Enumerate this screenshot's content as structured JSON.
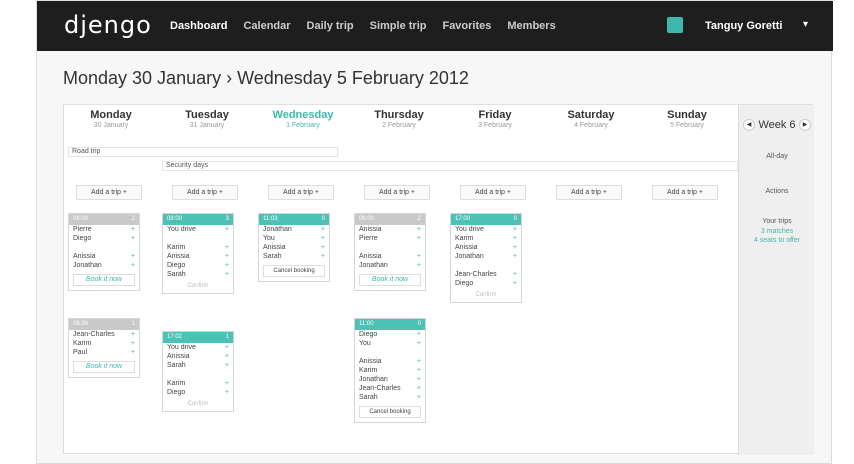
{
  "app": {
    "logo": "djengo",
    "nav": [
      "Dashboard",
      "Calendar",
      "Daily trip",
      "Simple trip",
      "Favorites",
      "Members"
    ],
    "user": "Tanguy Goretti"
  },
  "range": "Monday 30 January › Wednesday 5 February 2012",
  "days": [
    {
      "name": "Monday",
      "date": "30 January"
    },
    {
      "name": "Tuesday",
      "date": "31 January"
    },
    {
      "name": "Wednesday",
      "date": "1 February"
    },
    {
      "name": "Thursday",
      "date": "2 February"
    },
    {
      "name": "Friday",
      "date": "3 February"
    },
    {
      "name": "Saturday",
      "date": "4 February"
    },
    {
      "name": "Sunday",
      "date": "5 February"
    }
  ],
  "bars": {
    "road_trip": "Road trip",
    "security": "Security days"
  },
  "add_label": "Add a trip",
  "side": {
    "week": "Week 6",
    "allday": "All-day",
    "actions": "Actions",
    "your_trips": "Your trips",
    "matches": "3 matches",
    "seats": "4 seats to offer"
  },
  "cards": [
    {
      "time": "08:00",
      "n": "2",
      "rows": [
        "Pierre",
        "Diego",
        "",
        "Anissia",
        "Jonathan"
      ],
      "foot": "Book it now"
    },
    {
      "time": "08:30",
      "n": "1",
      "rows": [
        "Jean-Charles",
        "Karim",
        "Paul"
      ],
      "foot": "Book it now"
    },
    {
      "time": "08:00",
      "n": "3",
      "rows": [
        "You drive",
        "",
        "Karim",
        "Anissia",
        "Diego",
        "Sarah"
      ],
      "foot": "Confirm"
    },
    {
      "time": "17:02",
      "n": "1",
      "rows": [
        "You drive",
        "Anissia",
        "Sarah",
        "",
        "Karim",
        "Diego"
      ],
      "foot": "Confirm"
    },
    {
      "time": "11:03",
      "n": "0",
      "rows": [
        "Jonathan",
        "You",
        "Anissia",
        "Sarah"
      ],
      "foot": "Cancel booking"
    },
    {
      "time": "06:00",
      "n": "2",
      "rows": [
        "Anissia",
        "Pierre",
        "",
        "Anissia",
        "Jonathan"
      ],
      "foot": "Book it now"
    },
    {
      "time": "11:00",
      "n": "0",
      "rows": [
        "Diego",
        "You",
        "",
        "Anissia",
        "Karim",
        "Jonathan",
        "Jean-Charles",
        "Sarah"
      ],
      "foot": "Cancel booking"
    },
    {
      "time": "17:00",
      "n": "0",
      "rows": [
        "You drive",
        "Karim",
        "Anissia",
        "Jonathan",
        "",
        "Jean-Charles",
        "Diego"
      ],
      "foot": "Confirm"
    }
  ]
}
